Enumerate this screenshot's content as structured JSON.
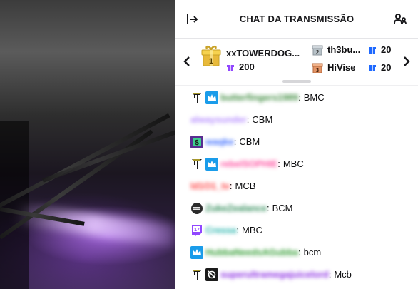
{
  "header": {
    "title": "CHAT DA TRANSMISSÃO",
    "collapse_icon": "collapse-arrow-icon",
    "users_icon": "community-icon"
  },
  "leaderboard": {
    "first": {
      "rank": "1",
      "name": "xxTOWERDOG...",
      "value": "200"
    },
    "second": {
      "rank": "2",
      "name": "th3bu...",
      "value": "20"
    },
    "third": {
      "rank": "3",
      "name": "HiVise",
      "value": "20"
    },
    "gift_color": "#9147ff",
    "gift_color_small": "#1f69ff"
  },
  "messages": [
    {
      "badges": [
        "tourney-badge",
        "prime-crown-badge"
      ],
      "username": "butterfingers1989",
      "color": "#3c8a3c",
      "separator": ":",
      "text": "BMC"
    },
    {
      "badges": [],
      "username": "alwaysunder",
      "color": "#b58cff",
      "separator": ":",
      "text": "CBM"
    },
    {
      "badges": [
        "sub-badge"
      ],
      "username": "waqke",
      "color": "#3b6bff",
      "separator": ":",
      "text": "CBM"
    },
    {
      "badges": [
        "tourney-badge",
        "prime-crown-badge"
      ],
      "username": "rebelSOPHIE",
      "color": "#ff4fa0",
      "separator": ":",
      "text": "MBC"
    },
    {
      "badges": [],
      "username": "ld1O1_tv",
      "color": "#ff3b3b",
      "separator": ":",
      "text": "MCB"
    },
    {
      "badges": [
        "helmet-badge"
      ],
      "username": "ZukeZealance",
      "color": "#2e8b57",
      "separator": ":",
      "text": "BCM"
    },
    {
      "badges": [
        "twitch-17-badge"
      ],
      "username": "Cressa",
      "color": "#20b2aa",
      "separator": ":",
      "text": "MBC"
    },
    {
      "badges": [
        "prime-crown-badge"
      ],
      "username": "HubbaNeedsAGubba",
      "color": "#2e9b2e",
      "separator": ":",
      "text": "bcm"
    },
    {
      "badges": [
        "tourney-badge",
        "no-audio-badge"
      ],
      "username": "superultramegajuicelord",
      "color": "#8a2be2",
      "separator": ":",
      "text": "Mcb"
    }
  ]
}
